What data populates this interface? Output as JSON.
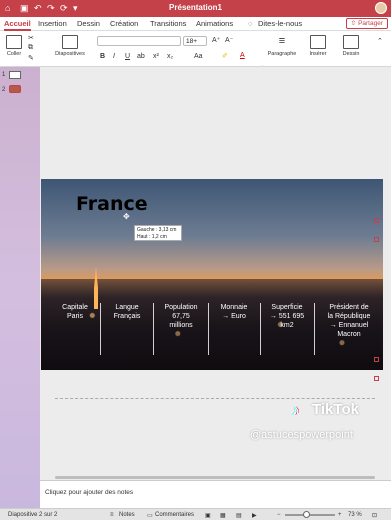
{
  "titlebar": {
    "title": "Présentation1",
    "quick_access": [
      "⌂",
      "▣",
      "↶",
      "↷",
      "⟳",
      "▾"
    ]
  },
  "tabs": [
    "Accueil",
    "Insertion",
    "Dessin",
    "Création",
    "Transitions",
    "Animations",
    "Dites-le-nous"
  ],
  "share_label": "Partager",
  "ribbon": {
    "paste": "Coller",
    "slides": "Diapositives",
    "font_size": "18+",
    "format": [
      "B",
      "I",
      "S",
      "U",
      "ab",
      "x²",
      "x₂",
      "Aa"
    ],
    "paragraph": "Paragraphe",
    "insert": "Insérer",
    "drawing": "Dessin"
  },
  "thumbnails": [
    "1",
    "2"
  ],
  "slide": {
    "title": "France",
    "tooltip": [
      "Gauche : 3,13 cm",
      "Haut : 1,2 cm"
    ],
    "stats": [
      {
        "l1": "Capitale",
        "l2": "Paris",
        "l3": ""
      },
      {
        "l1": "Langue",
        "l2": "Français",
        "l3": ""
      },
      {
        "l1": "Population",
        "l2": "67,75",
        "l3": "millions"
      },
      {
        "l1": "Monnaie",
        "l2": "→ Euro",
        "l3": ""
      },
      {
        "l1": "Superficie",
        "l2": "→ 551 695",
        "l3": "km2"
      },
      {
        "l1": "Président de",
        "l2": "la République",
        "l3": "→ Ennanuel",
        "l4": "Macron"
      }
    ]
  },
  "watermark": {
    "brand": "TikTok",
    "handle": "@astucespowerpoint"
  },
  "notes_placeholder": "Cliquez pour ajouter des notes",
  "status": {
    "slide_count": "Diapositive 2 sur 2",
    "notes": "Notes",
    "comments": "Commentaires",
    "zoom": "73 %",
    "minus": "−",
    "plus": "+"
  },
  "colors": {
    "accent": "#c4414a"
  }
}
